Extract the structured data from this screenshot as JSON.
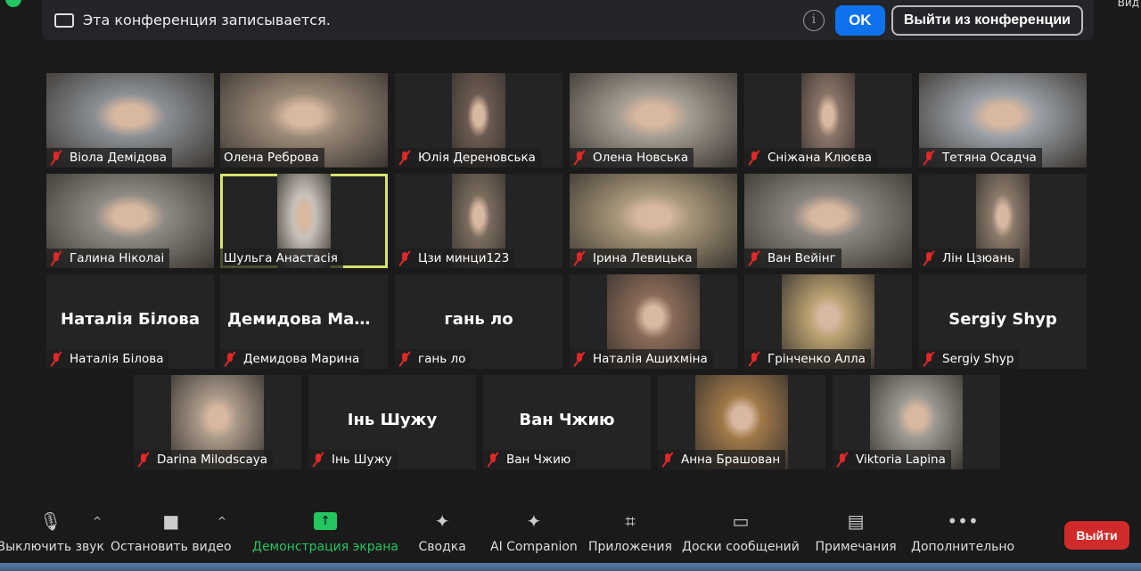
{
  "banner": {
    "text": "Эта конференция записывается.",
    "ok_label": "OK",
    "leave_label": "Выйти из конференции",
    "view_label": "Вид"
  },
  "participants": [
    {
      "name": "Віола Демідова",
      "muted": true,
      "video": "full",
      "color": "#8a8f94"
    },
    {
      "name": "Олена Реброва",
      "muted": false,
      "video": "full",
      "color": "#9b8a78"
    },
    {
      "name": "Юлія Деренoвська",
      "muted": true,
      "video": "narrow",
      "color": "#6b5a50"
    },
    {
      "name": "Олена Новська",
      "muted": true,
      "video": "full",
      "color": "#a69d92"
    },
    {
      "name": "Сніжана Клюєва",
      "muted": true,
      "video": "narrow",
      "color": "#8a7468"
    },
    {
      "name": "Тетяна Осадча",
      "muted": true,
      "video": "full",
      "color": "#9aa0a6"
    },
    {
      "name": "Галина Ніколаі",
      "muted": true,
      "video": "full",
      "color": "#8d8a84"
    },
    {
      "name": "Шульга Анастасія",
      "muted": false,
      "video": "narrow",
      "color": "#c8c2ba",
      "active": true
    },
    {
      "name": "Цзи минци123",
      "muted": true,
      "video": "narrow",
      "color": "#7a6c5e"
    },
    {
      "name": "Ірина Левицька",
      "muted": true,
      "video": "full",
      "color": "#a8987a"
    },
    {
      "name": "Ван Вейінг",
      "muted": true,
      "video": "full",
      "color": "#8c8680"
    },
    {
      "name": "Лін Цзюань",
      "muted": true,
      "video": "narrow",
      "color": "#8a7a6a"
    },
    {
      "name": "Наталія Білова",
      "muted": true,
      "video": "none"
    },
    {
      "name": "Демидова Марина",
      "muted": true,
      "video": "none"
    },
    {
      "name": "гань ло",
      "muted": true,
      "video": "none"
    },
    {
      "name": "Наталія Ашихміна",
      "muted": true,
      "video": "mid",
      "color": "#8a6a58"
    },
    {
      "name": "Грінченко Алла",
      "muted": true,
      "video": "mid",
      "color": "#b8a070"
    },
    {
      "name": "Sergiy Shyp",
      "muted": true,
      "video": "none"
    },
    {
      "name": "Darina Milodscaya",
      "muted": true,
      "video": "mid",
      "color": "#a89888"
    },
    {
      "name": "Інь Шужу",
      "muted": true,
      "video": "none"
    },
    {
      "name": "Ван Чжию",
      "muted": true,
      "video": "none"
    },
    {
      "name": "Анна Брашован",
      "muted": true,
      "video": "mid",
      "color": "#a07848"
    },
    {
      "name": "Viktoria Lapina",
      "muted": true,
      "video": "mid",
      "color": "#9a9890"
    }
  ],
  "toolbar": {
    "items": [
      {
        "label": "Выключить звук",
        "icon": "microphone-icon",
        "glyph": "🎙",
        "caret": true
      },
      {
        "label": "Остановить видео",
        "icon": "video-camera-icon",
        "glyph": "■",
        "caret": true
      },
      {
        "label": "Демонстрация экрана",
        "icon": "share-screen-icon",
        "glyph": "↑"
      },
      {
        "label": "Сводка",
        "icon": "summary-icon",
        "glyph": "✦"
      },
      {
        "label": "AI Companion",
        "icon": "ai-sparkle-icon",
        "glyph": "✦"
      },
      {
        "label": "Приложения",
        "icon": "apps-icon",
        "glyph": "⌗"
      },
      {
        "label": "Доски сообщений",
        "icon": "whiteboard-icon",
        "glyph": "▭"
      },
      {
        "label": "Примечания",
        "icon": "notes-icon",
        "glyph": "▤"
      },
      {
        "label": "Дополнительно",
        "icon": "more-icon",
        "glyph": "•••"
      }
    ],
    "end_label": "Выйти"
  },
  "colors": {
    "accent": "#0e72ed",
    "share": "#22c55e",
    "end": "#d12a2a",
    "active_speaker": "#d7e36a"
  }
}
